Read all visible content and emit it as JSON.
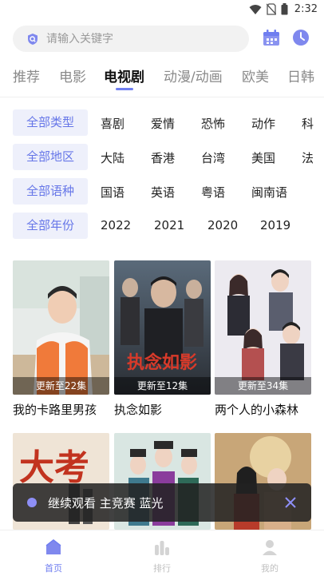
{
  "status_bar": {
    "time": "2:32"
  },
  "search": {
    "placeholder": "请输入关键字"
  },
  "tabs": [
    {
      "label": "推荐",
      "active": false
    },
    {
      "label": "电影",
      "active": false
    },
    {
      "label": "电视剧",
      "active": true
    },
    {
      "label": "动漫/动画",
      "active": false
    },
    {
      "label": "欧美",
      "active": false
    },
    {
      "label": "日韩",
      "active": false
    }
  ],
  "filters": {
    "type": {
      "all_label": "全部类型",
      "options": [
        "喜剧",
        "爱情",
        "恐怖",
        "动作",
        "科"
      ]
    },
    "region": {
      "all_label": "全部地区",
      "options": [
        "大陆",
        "香港",
        "台湾",
        "美国",
        "法"
      ]
    },
    "language": {
      "all_label": "全部语种",
      "options": [
        "国语",
        "英语",
        "粤语",
        "闽南语"
      ]
    },
    "year": {
      "all_label": "全部年份",
      "options": [
        "2022",
        "2021",
        "2020",
        "2019"
      ]
    }
  },
  "cards": [
    {
      "title": "我的卡路里男孩",
      "badge": "更新至22集"
    },
    {
      "title": "执念如影",
      "badge": "更新至12集",
      "poster_text": "执念如影"
    },
    {
      "title": "两个人的小森林",
      "badge": "更新至34集"
    },
    {
      "title": "",
      "badge": "",
      "poster_text": "大考"
    },
    {
      "title": "",
      "badge": ""
    },
    {
      "title": "",
      "badge": ""
    }
  ],
  "toast": {
    "text": "继续观看 主竞赛 蓝光"
  },
  "bottom_nav": [
    {
      "label": "首页",
      "active": true
    },
    {
      "label": "排行",
      "active": false
    },
    {
      "label": "我的",
      "active": false
    }
  ],
  "colors": {
    "accent": "#6f7ef0",
    "filter_bg": "#eef0fb",
    "filter_text": "#6676e8"
  }
}
